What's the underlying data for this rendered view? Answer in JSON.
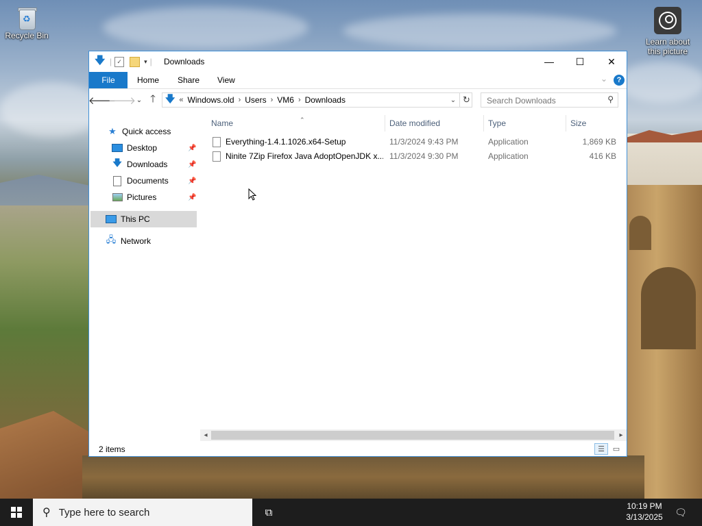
{
  "desktop": {
    "icons": [
      {
        "label": "Recycle Bin",
        "icon": "recycle-bin-icon"
      },
      {
        "label": "Learn about this picture",
        "icon": "camera-icon"
      }
    ]
  },
  "window": {
    "title": "Downloads",
    "controls": {
      "minimize": "—",
      "maximize": "☐",
      "close": "✕"
    },
    "ribbon_tabs": [
      "File",
      "Home",
      "Share",
      "View"
    ],
    "address": {
      "prefix": "«",
      "parts": [
        "Windows.old",
        "Users",
        "VM6",
        "Downloads"
      ]
    },
    "search": {
      "placeholder": "Search Downloads"
    },
    "nav_pane": {
      "quick_access": "Quick access",
      "items": [
        {
          "label": "Desktop",
          "icon": "desktop-icon",
          "pinned": true
        },
        {
          "label": "Downloads",
          "icon": "download-icon",
          "pinned": true
        },
        {
          "label": "Documents",
          "icon": "documents-icon",
          "pinned": true
        },
        {
          "label": "Pictures",
          "icon": "pictures-icon",
          "pinned": true
        }
      ],
      "this_pc": "This PC",
      "network": "Network"
    },
    "columns": {
      "name": "Name",
      "date": "Date modified",
      "type": "Type",
      "size": "Size"
    },
    "files": [
      {
        "name": "Everything-1.4.1.1026.x64-Setup",
        "date": "11/3/2024 9:43 PM",
        "type": "Application",
        "size": "1,869 KB"
      },
      {
        "name": "Ninite 7Zip Firefox Java AdoptOpenJDK x...",
        "date": "11/3/2024 9:30 PM",
        "type": "Application",
        "size": "416 KB"
      }
    ],
    "status": {
      "count": "2 items"
    }
  },
  "taskbar": {
    "search_placeholder": "Type here to search",
    "time": "10:19 PM",
    "date": "3/13/2025"
  },
  "colors": {
    "accent": "#1979ca",
    "taskbar": "#1d1d1d"
  }
}
